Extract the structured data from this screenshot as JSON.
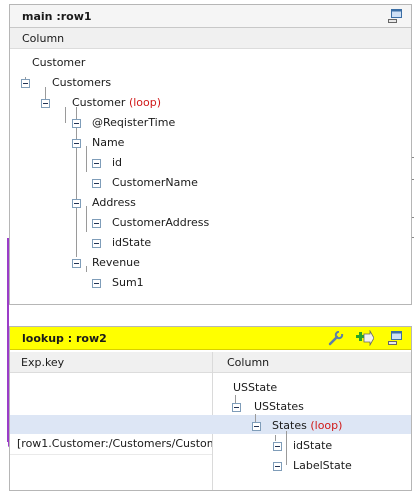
{
  "main": {
    "title": "main :row1",
    "column_header": "Column",
    "tree": {
      "root": "Customer",
      "customers": "Customers",
      "customer": "Customer",
      "customer_loop": "(loop)",
      "register_time": "@ReqisterTime",
      "name": "Name",
      "id": "id",
      "customer_name": "CustomerName",
      "address": "Address",
      "customer_address": "CustomerAddress",
      "id_state": "idState",
      "revenue": "Revenue",
      "sum1": "Sum1"
    }
  },
  "lookup": {
    "title": "lookup : row2",
    "expkey_header": "Exp.key",
    "column_header": "Column",
    "expression": "[row1.Customer:/Customers/Custom",
    "tree": {
      "root": "USState",
      "usstates": "USStates",
      "states": "States",
      "states_loop": "(loop)",
      "id_state": "idState",
      "label_state": "LabelState"
    }
  },
  "icons": [
    "minimize-icon",
    "wrench-icon",
    "add-join-icon",
    "minimize-icon"
  ],
  "colors": {
    "lookup_title_bg": "#ffff00",
    "loop_text": "#d01818",
    "link_line": "#9b3cc8",
    "selected_row": "#dde6f5"
  }
}
